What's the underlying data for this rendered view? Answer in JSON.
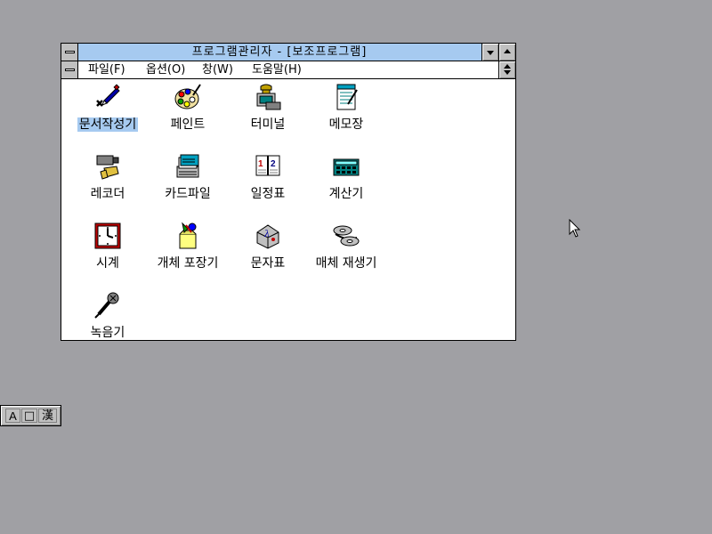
{
  "window": {
    "title": "프로그램관리자 - [보조프로그램]",
    "menu": [
      "파일(F)",
      "옵션(O)",
      "창(W)",
      "도움말(H)"
    ]
  },
  "programs": [
    {
      "label": "문서작성기",
      "icon": "write-pen-icon",
      "selected": true
    },
    {
      "label": "페인트",
      "icon": "paint-palette-icon"
    },
    {
      "label": "터미널",
      "icon": "terminal-phone-icon"
    },
    {
      "label": "메모장",
      "icon": "notepad-icon"
    },
    {
      "label": "레코더",
      "icon": "recorder-camera-icon"
    },
    {
      "label": "카드파일",
      "icon": "cardfile-icon"
    },
    {
      "label": "일정표",
      "icon": "calendar-icon"
    },
    {
      "label": "계산기",
      "icon": "calculator-icon"
    },
    {
      "label": "시계",
      "icon": "clock-icon"
    },
    {
      "label": "개체 포장기",
      "icon": "object-packager-icon"
    },
    {
      "label": "문자표",
      "icon": "character-map-icon"
    },
    {
      "label": "매체 재생기",
      "icon": "media-player-icon"
    },
    {
      "label": "녹음기",
      "icon": "sound-recorder-microphone-icon"
    }
  ],
  "ime": {
    "mode_latin": "A",
    "mode_cursor": "□",
    "mode_hanja": "漢"
  },
  "colors": {
    "desktop": "#a0a0a4",
    "titlebar_active": "#a6caf0",
    "selection": "#a6caf0"
  }
}
